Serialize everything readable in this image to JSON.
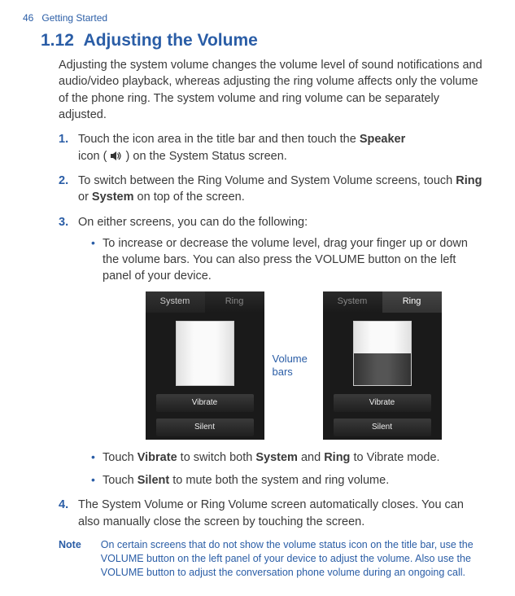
{
  "header": {
    "page_number": "46",
    "chapter": "Getting Started"
  },
  "section": {
    "number": "1.12",
    "title": "Adjusting the Volume"
  },
  "intro": "Adjusting the system volume changes the volume level of sound notifications and audio/video playback, whereas adjusting the ring volume affects only the volume of the phone ring. The system volume and ring volume can be separately adjusted.",
  "step1": {
    "num": "1.",
    "text_a": "Touch the icon area in the title bar and then touch the ",
    "bold_a": "Speaker",
    "text_b": " icon ( ",
    "text_c": " ) on the System Status screen."
  },
  "step2": {
    "num": "2.",
    "text_a": "To switch between the Ring Volume and System Volume screens, touch ",
    "bold_a": "Ring",
    "text_b": " or ",
    "bold_b": "System",
    "text_c": " on top of the screen."
  },
  "step3": {
    "num": "3.",
    "text": "On either screens, you can do the following:",
    "bullet1": "To increase or decrease the volume level, drag your finger up or down the volume bars. You can also press the VOLUME button on the left panel of your device.",
    "bullet2_a": "Touch ",
    "bullet2_b1": "Vibrate",
    "bullet2_c": " to switch both ",
    "bullet2_b2": "System",
    "bullet2_d": " and ",
    "bullet2_b3": "Ring",
    "bullet2_e": " to Vibrate mode.",
    "bullet3_a": "Touch ",
    "bullet3_b": "Silent",
    "bullet3_c": " to mute both the system and ring volume."
  },
  "step4": {
    "num": "4.",
    "text": "The System Volume or Ring Volume screen automatically closes. You can also manually close the screen by touching the screen."
  },
  "figure": {
    "tab_system": "System",
    "tab_ring": "Ring",
    "btn_vibrate": "Vibrate",
    "btn_silent": "Silent",
    "label_line1": "Volume",
    "label_line2": "bars"
  },
  "note": {
    "label": "Note",
    "text": "On certain screens that do not show the volume status icon on the title bar, use the VOLUME button on the left panel of your device to adjust the volume. Also use the VOLUME button to adjust the conversation phone volume during an ongoing call."
  }
}
